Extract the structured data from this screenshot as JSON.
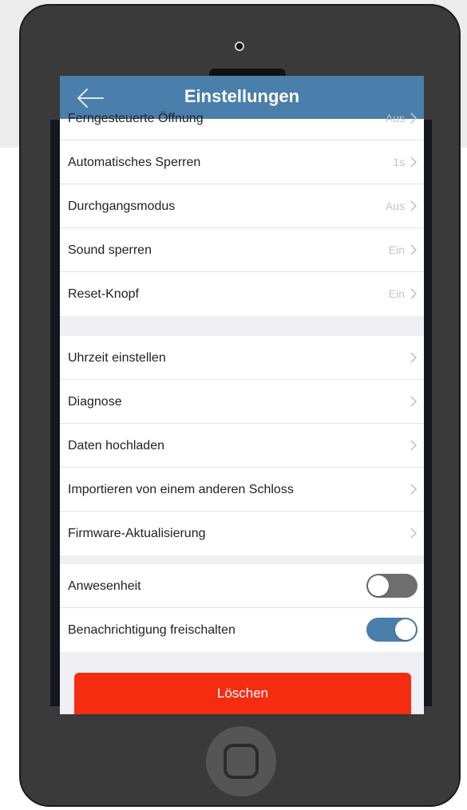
{
  "colors": {
    "header_bg": "#4a7eab",
    "delete_bg": "#f52c10",
    "device_body": "#3a3a3a",
    "toggle_on": "#4a7eab",
    "toggle_off": "#6e6e6e"
  },
  "header": {
    "title": "Einstellungen",
    "back_icon": "arrow-left-icon"
  },
  "groups": [
    {
      "items": [
        {
          "label": "Ferngesteuerte Öffnung",
          "value": "Aus"
        },
        {
          "label": "Automatisches Sperren",
          "value": "1s"
        },
        {
          "label": "Durchgangsmodus",
          "value": "Aus"
        },
        {
          "label": "Sound sperren",
          "value": "Ein"
        },
        {
          "label": "Reset-Knopf",
          "value": "Ein"
        }
      ]
    },
    {
      "items": [
        {
          "label": "Uhrzeit einstellen"
        },
        {
          "label": "Diagnose"
        },
        {
          "label": "Daten hochladen"
        },
        {
          "label": "Importieren von einem anderen Schloss"
        },
        {
          "label": "Firmware-Aktualisierung"
        }
      ]
    },
    {
      "items": [
        {
          "label": "Anwesenheit",
          "toggle": false
        },
        {
          "label": "Benachrichtigung freischalten",
          "toggle": true
        }
      ]
    }
  ],
  "delete_button": {
    "label": "Löschen"
  }
}
